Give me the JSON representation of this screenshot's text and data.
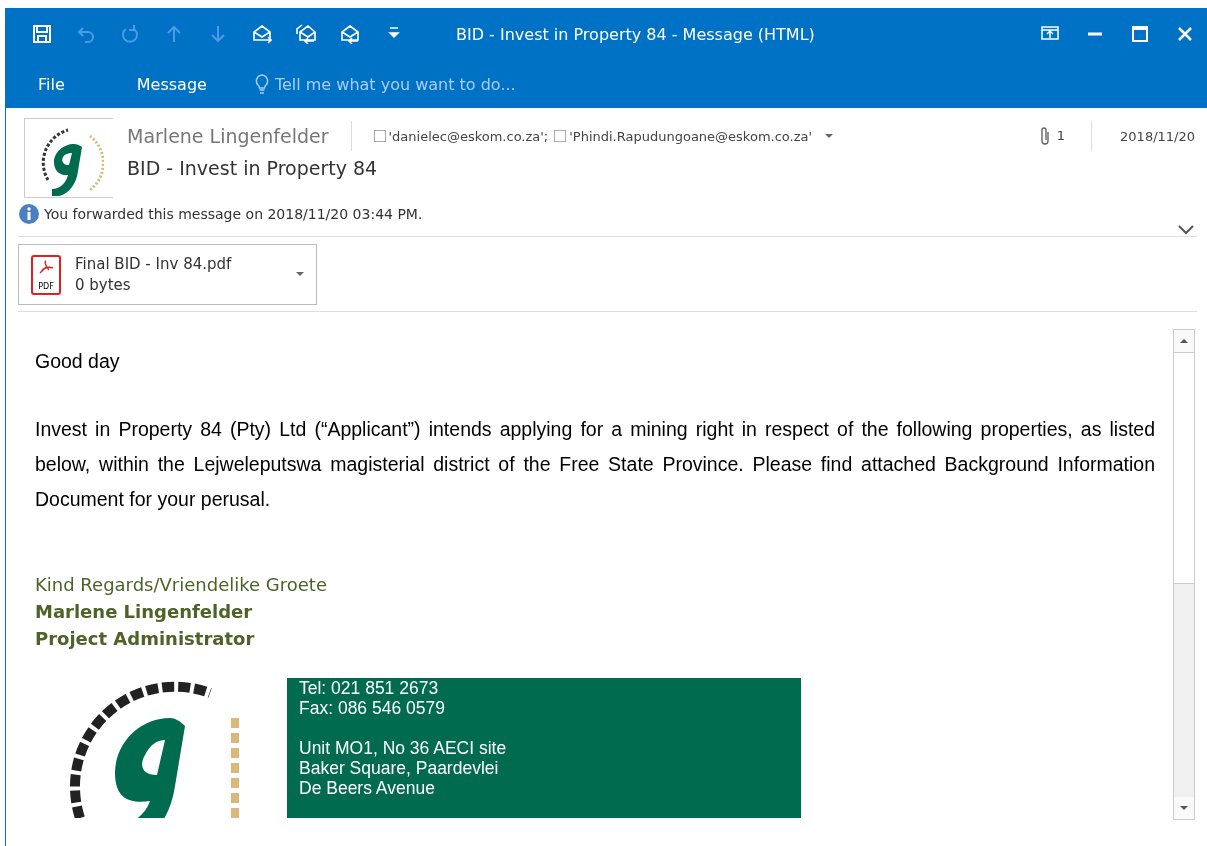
{
  "window": {
    "title": "BID - Invest in Property 84 - Message (HTML)"
  },
  "quick_access": [
    {
      "kind": "save",
      "disabled": false
    },
    {
      "kind": "undo",
      "disabled": true
    },
    {
      "kind": "redo",
      "disabled": true
    },
    {
      "kind": "up",
      "disabled": true
    },
    {
      "kind": "down",
      "disabled": true
    },
    {
      "kind": "forward",
      "disabled": false
    },
    {
      "kind": "reply-all",
      "disabled": false
    },
    {
      "kind": "reply",
      "disabled": false
    },
    {
      "kind": "customize",
      "disabled": false
    }
  ],
  "ribbon_tabs": [
    {
      "label": "File"
    },
    {
      "label": "Message"
    }
  ],
  "tell_me": {
    "placeholder": "Tell me what you want to do..."
  },
  "message": {
    "sender": "Marlene Lingenfelder",
    "recipients": [
      "'danielec@eskom.co.za';",
      "'Phindi.Rapudungoane@eskom.co.za'"
    ],
    "attachment_count": "1",
    "date": "2018/11/20",
    "subject": "BID - Invest in Property 84",
    "info": "You forwarded this message on 2018/11/20 03:44 PM."
  },
  "attachments": [
    {
      "name": "Final BID - Inv 84.pdf",
      "size": "0 bytes",
      "icon_text": "PDF"
    }
  ],
  "body": {
    "paragraphs": [
      "Good day",
      "Invest in Property 84 (Pty) Ltd (“Applicant”) intends applying for a mining right in respect of the following properties, as listed below, within the Lejweleputswa magisterial district of the Free State Province. Please find attached Background Information Document for your perusal."
    ],
    "signature": {
      "closing": "Kind Regards/Vriendelike Groete",
      "name": "Marlene Lingenfelder",
      "title": "Project Administrator"
    },
    "contact_blocks": [
      [
        "Tel: 021 851 2673",
        "Fax: 086 546 0579"
      ],
      [
        "Unit MO1, No 36 AECI site",
        "Baker Square, Paardevlei",
        "De Beers Avenue"
      ]
    ]
  }
}
